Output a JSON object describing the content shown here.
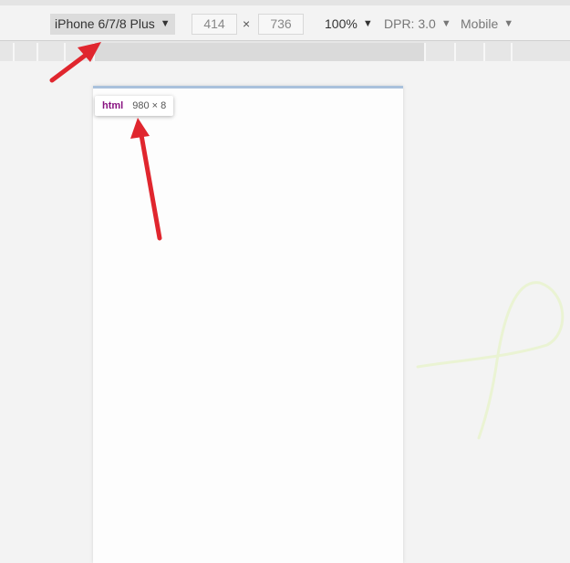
{
  "toolbar": {
    "device": "iPhone 6/7/8 Plus",
    "width": "414",
    "height": "736",
    "times": "×",
    "zoom": "100%",
    "dpr": "DPR: 3.0",
    "mode": "Mobile"
  },
  "tooltip": {
    "tag": "html",
    "size": "980 × 8"
  },
  "colors": {
    "annotation_arrow": "#e0262e",
    "viewport_border": "#a9c1dc",
    "tooltip_tag": "#881280"
  }
}
